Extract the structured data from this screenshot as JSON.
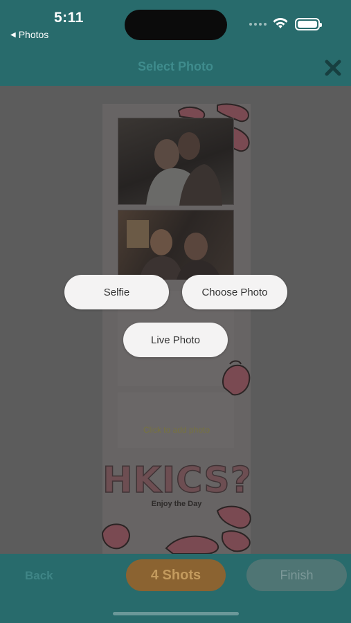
{
  "status_bar": {
    "time": "5:11",
    "back_app": "Photos"
  },
  "nav": {
    "title": "Select Photo"
  },
  "strip": {
    "caption": "Click to add photo",
    "brand": "HKICS?",
    "tagline": "Enjoy the Day"
  },
  "popup": {
    "selfie_label": "Selfie",
    "choose_label": "Choose Photo",
    "live_label": "Live Photo"
  },
  "bottom_bar": {
    "back_label": "Back",
    "shots_label": "4 Shots",
    "finish_label": "Finish"
  },
  "colors": {
    "teal_bar": "#286b6c",
    "overlay": "#5c5c5c",
    "accent_orange": "#8b6331",
    "pill_bg": "#f4f3f3"
  }
}
